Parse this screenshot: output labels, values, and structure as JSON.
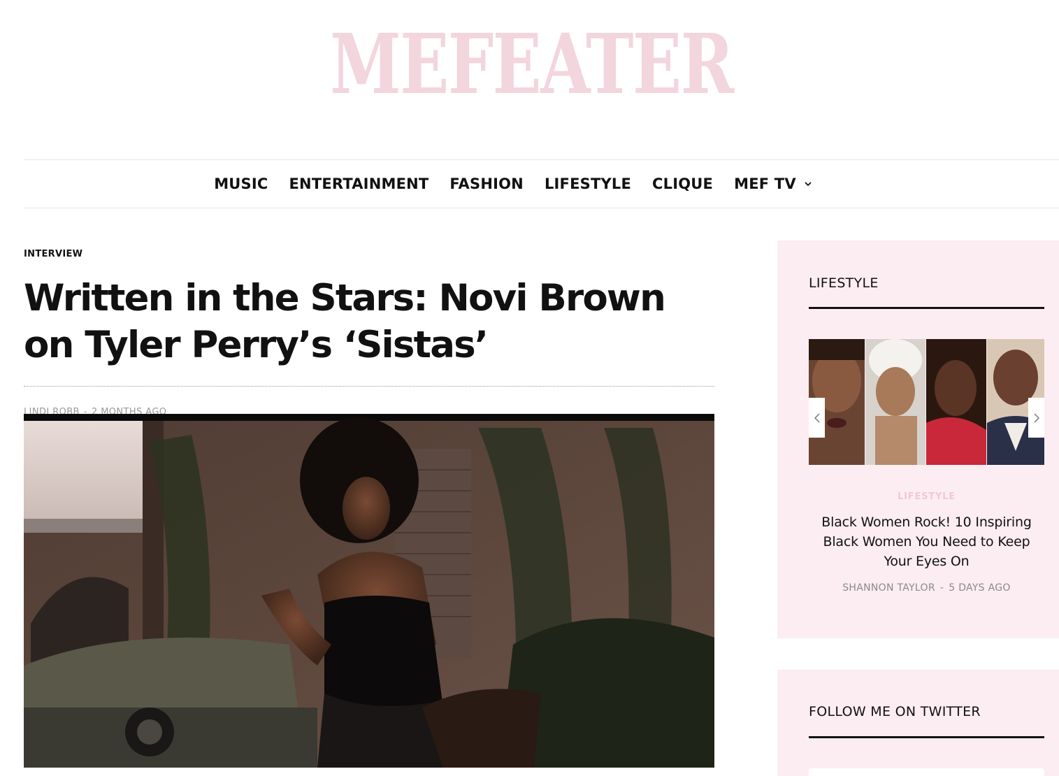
{
  "site": {
    "logo": "MEFEATER"
  },
  "nav": {
    "items": [
      "MUSIC",
      "ENTERTAINMENT",
      "FASHION",
      "LIFESTYLE",
      "CLIQUE",
      "MEF TV"
    ],
    "dropdown_icon": "chevron-down-icon"
  },
  "article": {
    "category": "INTERVIEW",
    "title": "Written in the Stars: Novi Brown on Tyler Perry’s ‘Sistas’",
    "author": "LINDI ROBB",
    "date": "2 MONTHS AGO",
    "separator": "-"
  },
  "sidebar": {
    "lifestyle_widget": {
      "heading": "LIFESTYLE",
      "post": {
        "category": "LIFESTYLE",
        "title": "Black Women Rock! 10 Inspiring Black Women You Need to Keep Your Eyes On",
        "author": "SHANNON TAYLOR",
        "date": "5 DAYS AGO",
        "separator": "-"
      },
      "prev_icon": "chevron-left-icon",
      "next_icon": "chevron-right-icon"
    },
    "twitter_widget": {
      "heading": "FOLLOW ME ON TWITTER"
    }
  },
  "colors": {
    "logo_pink": "#f3d5dd",
    "card_bg": "#fcedf2",
    "category_pink": "#f0c8d6"
  }
}
